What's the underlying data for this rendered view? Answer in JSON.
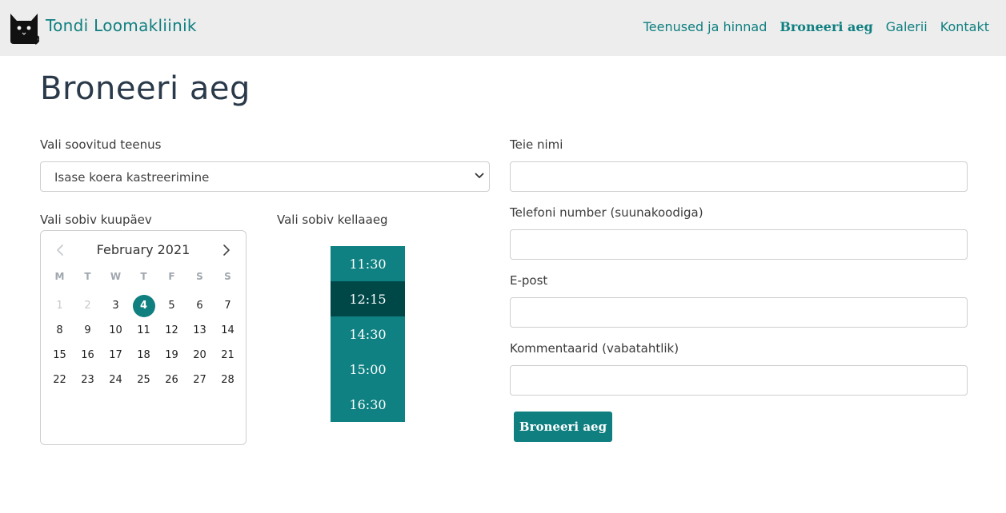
{
  "brand": {
    "name": "Tondi Loomakliinik",
    "logo_icon": "black-cat-icon"
  },
  "nav": {
    "items": [
      {
        "label": "Teenused ja hinnad"
      },
      {
        "label": "Broneeri aeg"
      },
      {
        "label": "Galerii"
      },
      {
        "label": "Kontakt"
      }
    ],
    "active": "Broneeri aeg"
  },
  "page": {
    "title": "Broneeri aeg"
  },
  "service": {
    "label": "Vali soovitud teenus",
    "selected": "Isase koera kastreerimine"
  },
  "date": {
    "label": "Vali sobiv kuupäev",
    "month_title": "February 2021",
    "weekdays": [
      "M",
      "T",
      "W",
      "T",
      "F",
      "S",
      "S"
    ],
    "days": [
      "1",
      "2",
      "3",
      "4",
      "5",
      "6",
      "7",
      "8",
      "9",
      "10",
      "11",
      "12",
      "13",
      "14",
      "15",
      "16",
      "17",
      "18",
      "19",
      "20",
      "21",
      "22",
      "23",
      "24",
      "25",
      "26",
      "27",
      "28"
    ],
    "disabled_days": [
      "1",
      "2"
    ],
    "selected_day": "4"
  },
  "time": {
    "label": "Vali sobiv kellaaeg",
    "slots": [
      "11:30",
      "12:15",
      "14:30",
      "15:00",
      "16:30"
    ],
    "selected": "12:15"
  },
  "form": {
    "name_label": "Teie nimi",
    "name_value": "",
    "phone_label": "Telefoni number (suunakoodiga)",
    "phone_value": "",
    "email_label": "E-post",
    "email_value": "",
    "comment_label": "Kommentaarid (vabatahtlik)",
    "comment_value": "",
    "submit_label": "Broneeri aeg"
  },
  "colors": {
    "accent": "#0f7f80",
    "slot_selected": "#004848",
    "navbar_bg": "#ededed",
    "title": "#2b3a4a"
  }
}
